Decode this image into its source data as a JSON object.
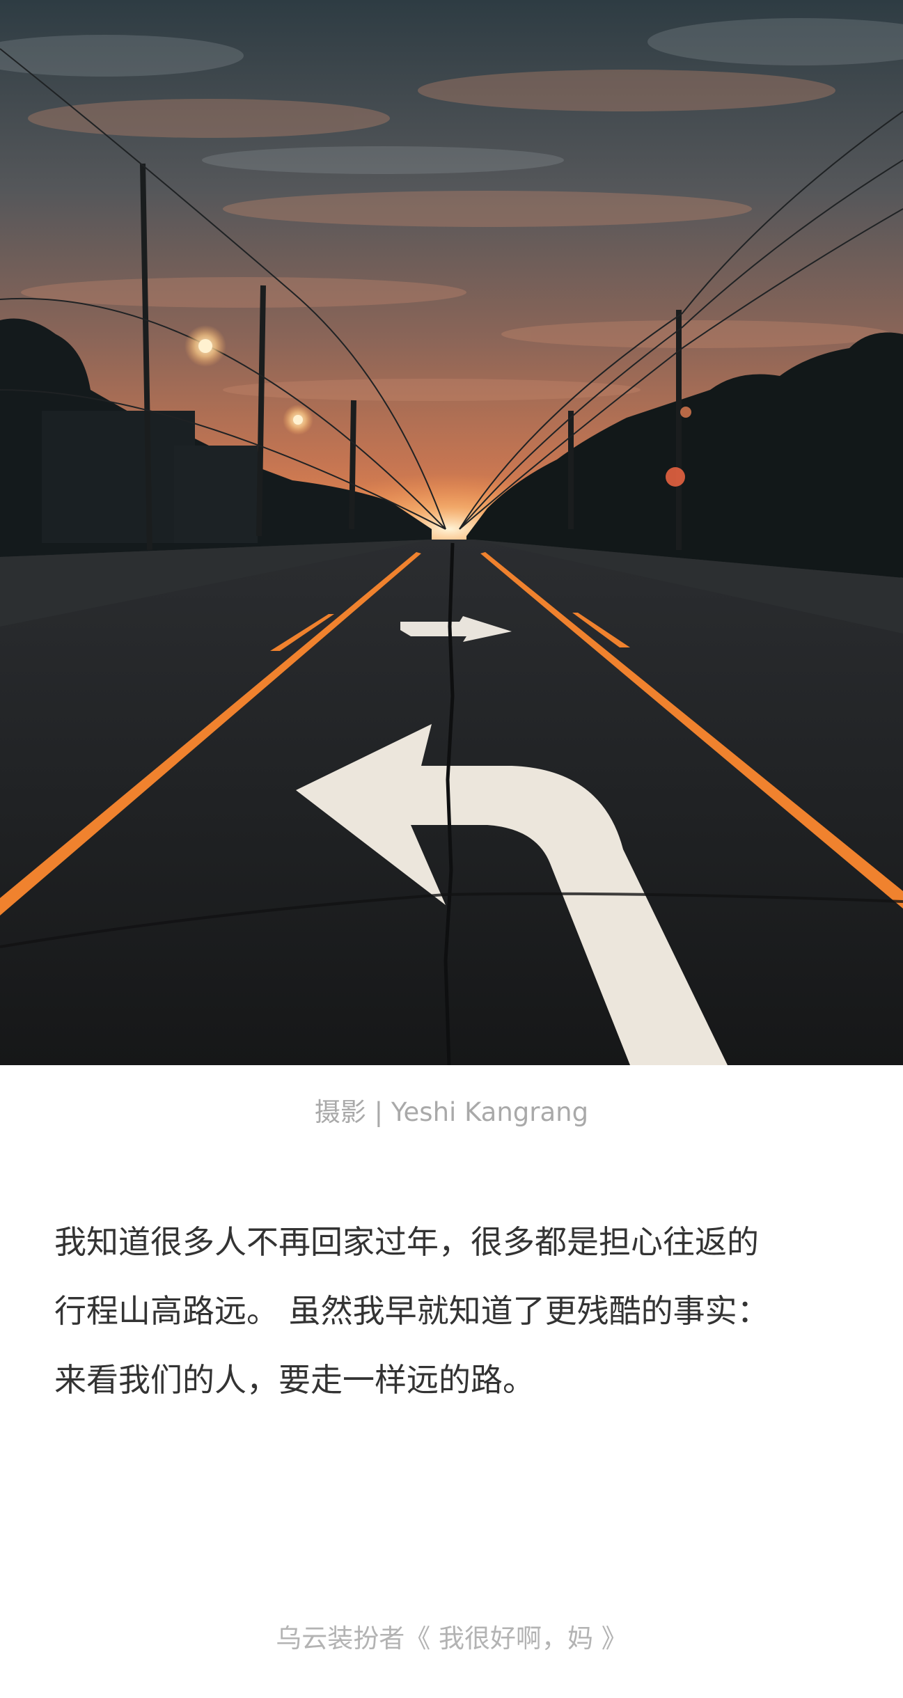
{
  "photo": {
    "subject": "road-with-turn-arrows-at-dusk",
    "colors": {
      "sky_top": "#34434a",
      "sky_mid": "#6a5a55",
      "horizon": "#e07a4a",
      "road": "#1e2022",
      "lane_line": "#f0822e",
      "arrow": "#f1ece4"
    }
  },
  "caption": {
    "text": "摄影 | Yeshi Kangrang"
  },
  "body": {
    "lines": [
      "我知道很多人不再回家过年，很多都是担心往返的",
      "行程山高路远。 虽然我早就知道了更残酷的事实：",
      "来看我们的人，要走一样远的路。"
    ]
  },
  "signature": {
    "text": "乌云装扮者《 我很好啊，妈 》"
  }
}
